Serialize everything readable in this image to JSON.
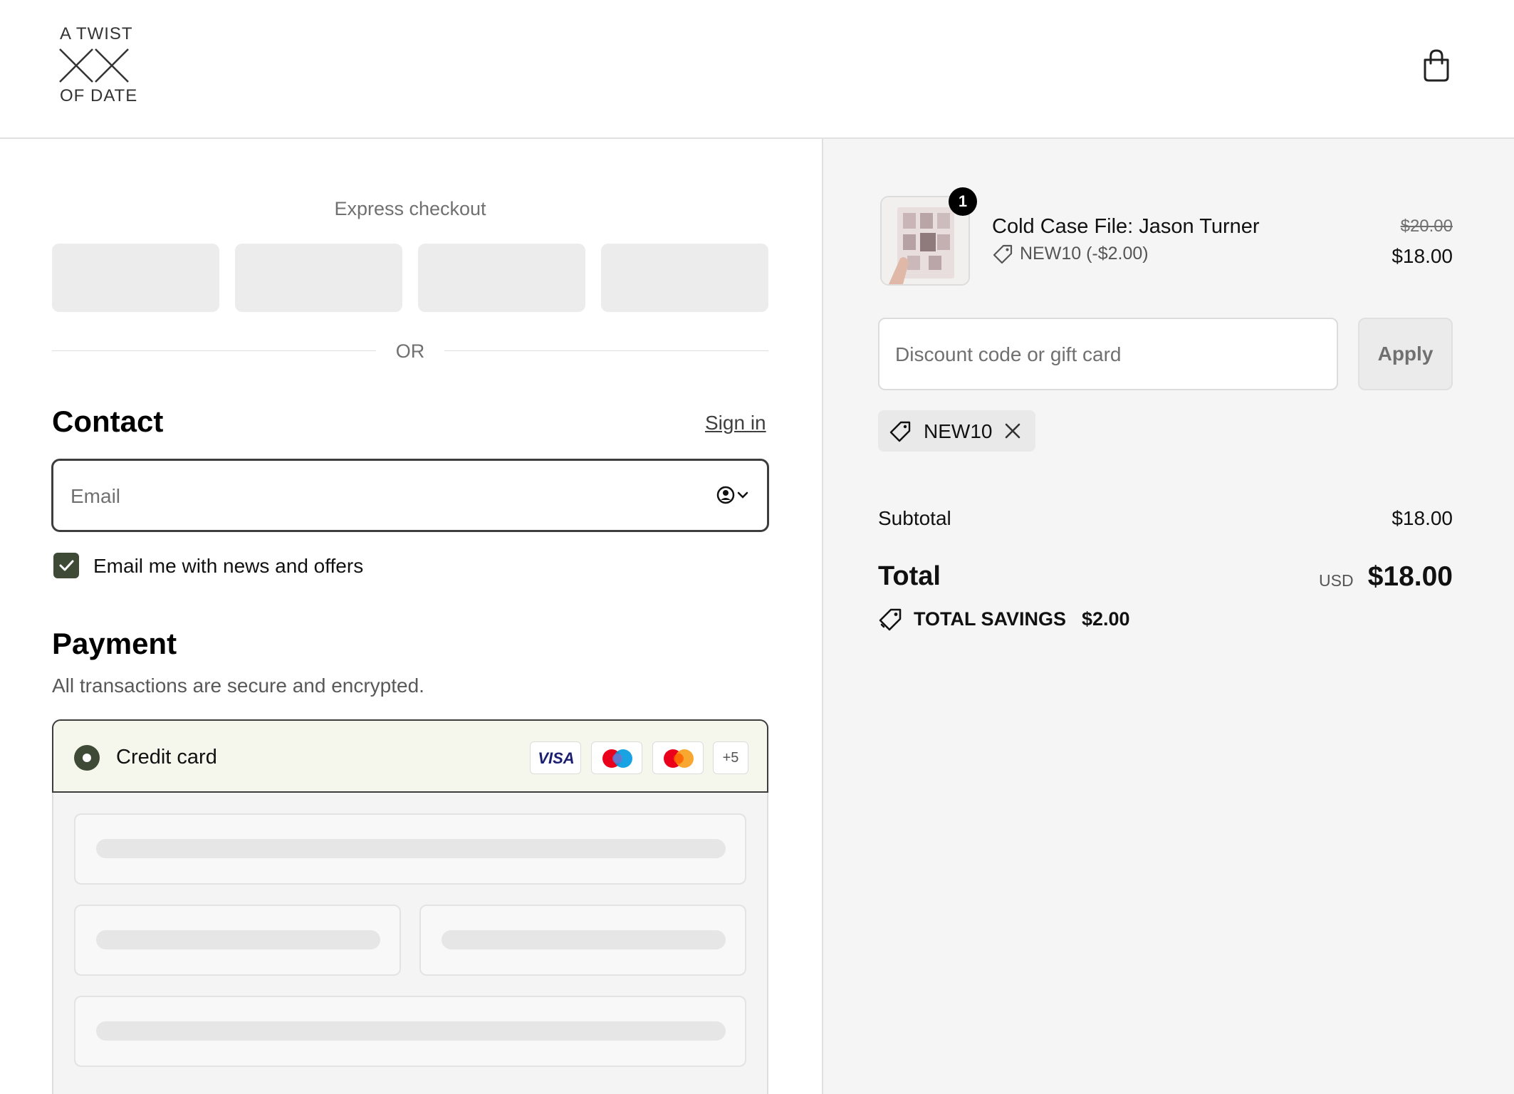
{
  "header": {
    "logo_top": "A TWIST",
    "logo_bottom": "OF DATE",
    "cart_icon": "shopping-bag-icon"
  },
  "express": {
    "title": "Express checkout",
    "or_label": "OR"
  },
  "contact": {
    "title": "Contact",
    "sign_in": "Sign in",
    "email_placeholder": "Email",
    "newsletter_label": "Email me with news and offers",
    "newsletter_checked": true
  },
  "payment": {
    "title": "Payment",
    "subtitle": "All transactions are secure and encrypted.",
    "method_label": "Credit card",
    "visa_label": "VISA",
    "more_cards": "+5"
  },
  "summary": {
    "item": {
      "quantity": "1",
      "name": "Cold Case File: Jason Turner",
      "discount": "NEW10 (-$2.00)",
      "price_original": "$20.00",
      "price_final": "$18.00"
    },
    "discount_placeholder": "Discount code or gift card",
    "apply_label": "Apply",
    "applied_code": "NEW10",
    "subtotal_label": "Subtotal",
    "subtotal_value": "$18.00",
    "total_label": "Total",
    "currency": "USD",
    "total_value": "$18.00",
    "savings_label": "TOTAL SAVINGS",
    "savings_value": "$2.00"
  },
  "colors": {
    "accent": "#3f4a36",
    "selected_panel": "#f6f7ec",
    "summary_bg": "#f5f5f5"
  }
}
